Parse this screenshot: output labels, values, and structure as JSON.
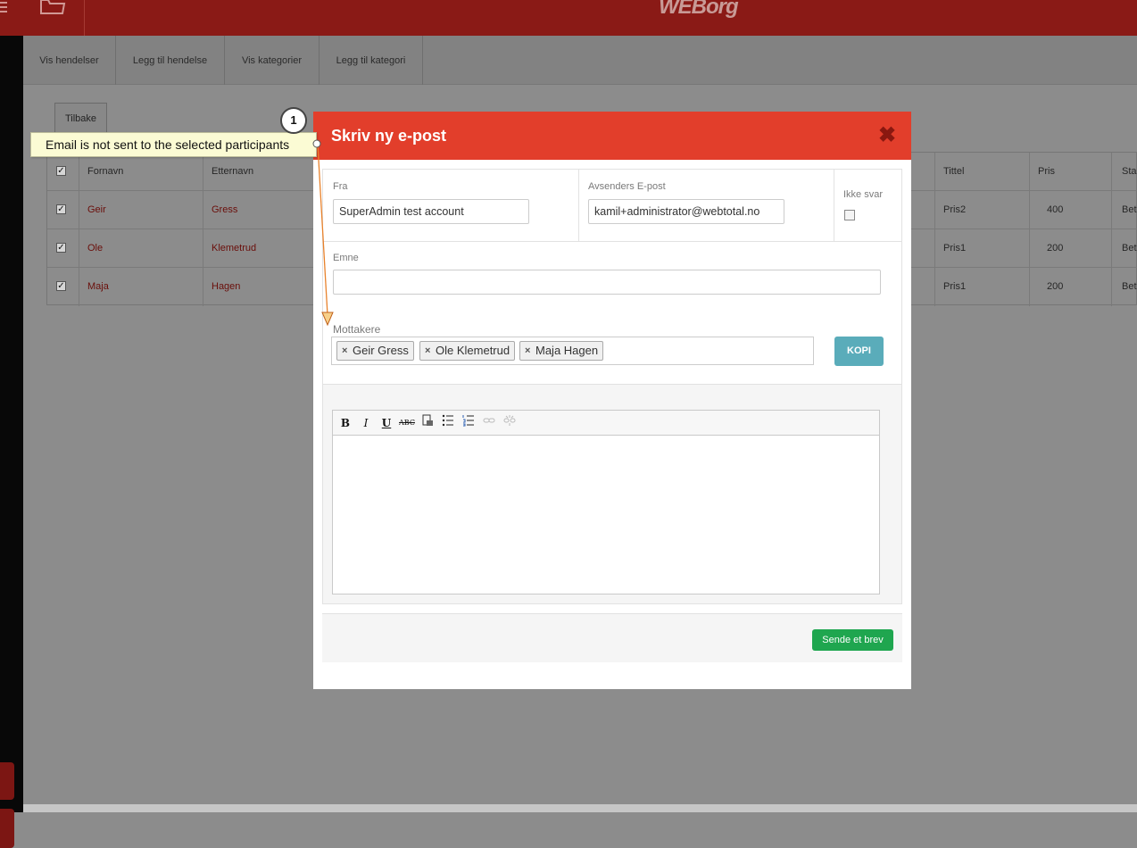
{
  "app": {
    "logo": "WEBorg"
  },
  "subnav": {
    "tabs": [
      {
        "label": "Vis hendelser"
      },
      {
        "label": "Legg til hendelse"
      },
      {
        "label": "Vis kategorier"
      },
      {
        "label": "Legg til kategori"
      }
    ]
  },
  "page": {
    "back_label": "Tilbake"
  },
  "table": {
    "headers": {
      "first": "Fornavn",
      "last": "Etternavn",
      "title": "Tittel",
      "price": "Pris",
      "status": "Sta"
    },
    "rows": [
      {
        "first": "Geir",
        "last": "Gress",
        "title": "Pris2",
        "price": "400",
        "status": "Bet"
      },
      {
        "first": "Ole",
        "last": "Klemetrud",
        "title": "Pris1",
        "price": "200",
        "status": "Bet"
      },
      {
        "first": "Maja",
        "last": "Hagen",
        "title": "Pris1",
        "price": "200",
        "status": "Bet"
      }
    ]
  },
  "modal": {
    "title": "Skriv ny e-post",
    "close_glyph": "✖",
    "from_label": "Fra",
    "from_value": "SuperAdmin test account",
    "sender_email_label": "Avsenders E-post",
    "sender_email_value": "kamil+administrator@webtotal.no",
    "no_reply_label": "Ikke svar",
    "subject_label": "Emne",
    "subject_value": "",
    "recipients_label": "Mottakere",
    "recipients": [
      "Geir Gress",
      "Ole Klemetrud",
      "Maja Hagen"
    ],
    "copy_button": "KOPI",
    "send_button": "Sende et brev",
    "toolbar": [
      "B",
      "I",
      "U",
      "ABC",
      "",
      "",
      "",
      "",
      ""
    ]
  },
  "annotation": {
    "step": "1",
    "note": "Email is not sent to the selected participants"
  },
  "colors": {
    "header_red": "#e23e2b",
    "kopi_teal": "#5aacba",
    "send_green": "#1fa64f",
    "note_yellow": "#fbfbd4"
  }
}
